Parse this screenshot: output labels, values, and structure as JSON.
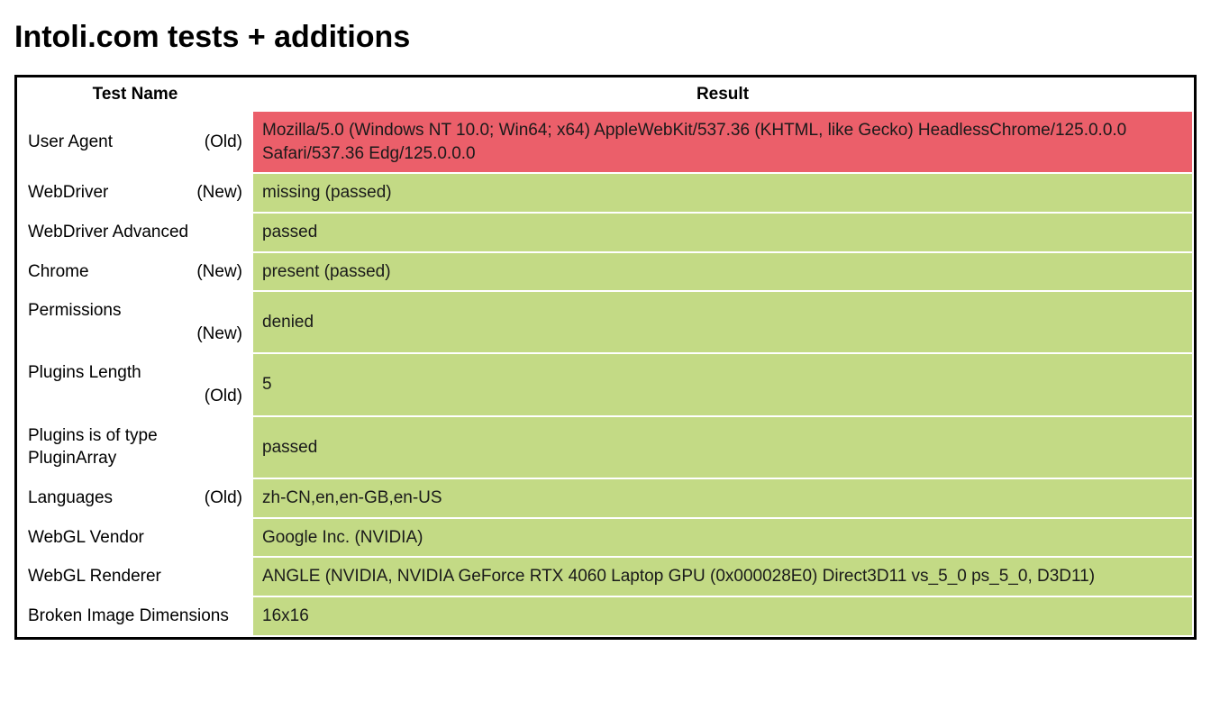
{
  "heading": "Intoli.com tests + additions",
  "columns": {
    "name": "Test Name",
    "result": "Result"
  },
  "status_colors": {
    "pass": "#c3da85",
    "fail": "#eb5f6a"
  },
  "rows": [
    {
      "name": "User Agent",
      "tag": "(Old)",
      "result": "Mozilla/5.0 (Windows NT 10.0; Win64; x64) AppleWebKit/537.36 (KHTML, like Gecko) HeadlessChrome/125.0.0.0 Safari/537.36 Edg/125.0.0.0",
      "status": "fail"
    },
    {
      "name": "WebDriver",
      "tag": "(New)",
      "result": "missing (passed)",
      "status": "pass"
    },
    {
      "name": "WebDriver Advanced",
      "tag": "",
      "result": "passed",
      "status": "pass"
    },
    {
      "name": "Chrome",
      "tag": "(New)",
      "result": "present (passed)",
      "status": "pass"
    },
    {
      "name": "Permissions",
      "tag": "(New)",
      "tag_below": true,
      "result": "denied",
      "status": "pass"
    },
    {
      "name": "Plugins Length",
      "tag": "(Old)",
      "tag_below": true,
      "result": "5",
      "status": "pass"
    },
    {
      "name": "Plugins is of type PluginArray",
      "tag": "",
      "result": "passed",
      "status": "pass"
    },
    {
      "name": "Languages",
      "tag": "(Old)",
      "result": "zh-CN,en,en-GB,en-US",
      "status": "pass"
    },
    {
      "name": "WebGL Vendor",
      "tag": "",
      "result": "Google Inc. (NVIDIA)",
      "status": "pass"
    },
    {
      "name": "WebGL Renderer",
      "tag": "",
      "result": "ANGLE (NVIDIA, NVIDIA GeForce RTX 4060 Laptop GPU (0x000028E0) Direct3D11 vs_5_0 ps_5_0, D3D11)",
      "status": "pass"
    },
    {
      "name": "Broken Image Dimensions",
      "tag": "",
      "result": "16x16",
      "status": "pass"
    }
  ]
}
